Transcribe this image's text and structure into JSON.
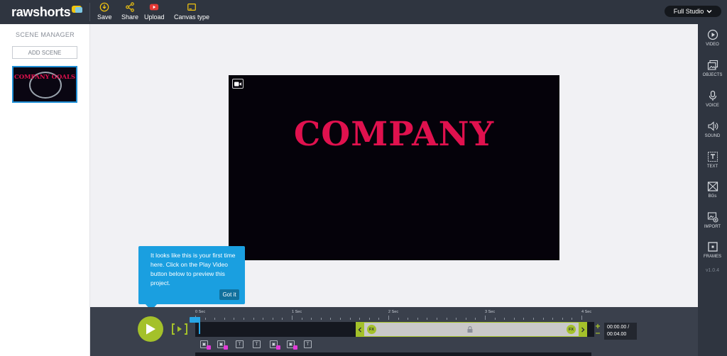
{
  "app": {
    "logo_text": "rawshorts"
  },
  "toolbar": {
    "save": "Save",
    "share": "Share",
    "upload": "Upload",
    "canvas_type": "Canvas type",
    "studio_select": "Full Studio"
  },
  "scene_manager": {
    "title": "SCENE MANAGER",
    "add_scene": "ADD SCENE",
    "thumbnail_text": "COMPANY GOALS"
  },
  "canvas": {
    "headline": "COMPANY",
    "background": "#05020a",
    "text_color": "#e0114e"
  },
  "right_sidebar": {
    "items": [
      {
        "label": "VIDEO",
        "icon": "play-circle-icon"
      },
      {
        "label": "OBJECTS",
        "icon": "image-stack-icon"
      },
      {
        "label": "VOICE",
        "icon": "microphone-icon"
      },
      {
        "label": "SOUND",
        "icon": "speaker-icon"
      },
      {
        "label": "TEXT",
        "icon": "text-box-icon"
      },
      {
        "label": "BGs",
        "icon": "background-icon"
      },
      {
        "label": "IMPORT",
        "icon": "import-image-icon"
      },
      {
        "label": "FRAMES",
        "icon": "frame-icon"
      }
    ],
    "version": "v1.0.4"
  },
  "tooltip": {
    "message": "It looks like this is your first time here. Click on the Play Video button below to preview this project.",
    "button": "Got it"
  },
  "timeline": {
    "ticks": [
      "0 Sec",
      "1 Sec",
      "2 Sec",
      "3 Sec",
      "4 Sec"
    ],
    "fx_label": "FX",
    "current_time": "00:00.00 /",
    "total_time": "00:04.00",
    "accent": "#a4c12a",
    "playhead_color": "#27a6e6"
  }
}
